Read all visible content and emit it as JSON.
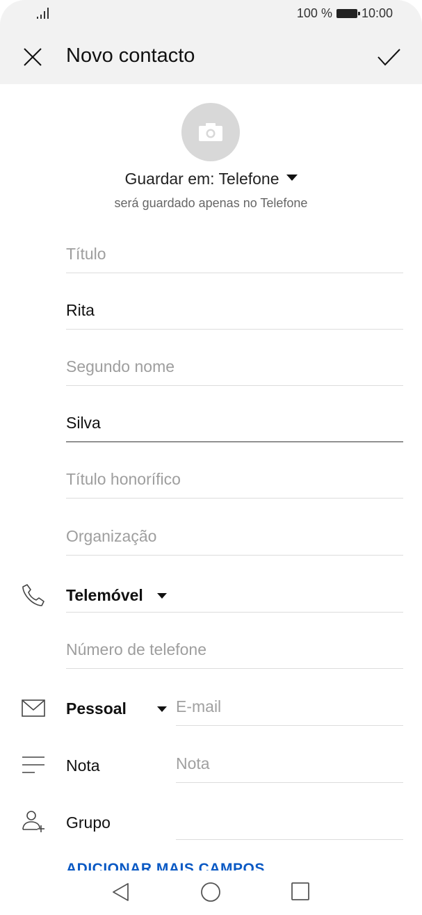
{
  "status": {
    "battery_text": "100 %",
    "time": "10:00"
  },
  "header": {
    "title": "Novo contacto"
  },
  "save": {
    "label": "Guardar em: Telefone",
    "sub": "será guardado apenas no Telefone"
  },
  "fields": {
    "title_placeholder": "Título",
    "first_name": "Rita",
    "middle_placeholder": "Segundo nome",
    "last_name": "Silva",
    "suffix_placeholder": "Título honorífico",
    "org_placeholder": "Organização"
  },
  "phone": {
    "type": "Telemóvel",
    "placeholder": "Número de telefone"
  },
  "email": {
    "type": "Pessoal",
    "placeholder": "E-mail"
  },
  "note": {
    "label": "Nota",
    "placeholder": "Nota"
  },
  "group": {
    "label": "Grupo"
  },
  "add_more": "ADICIONAR MAIS CAMPOS"
}
